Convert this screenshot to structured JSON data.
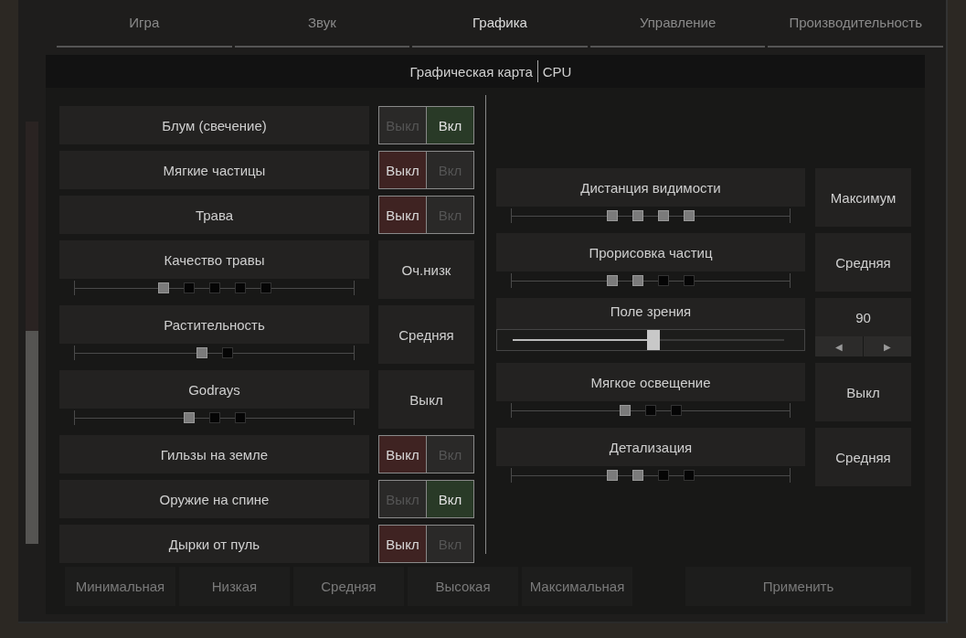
{
  "tabs": [
    {
      "label": "Игра",
      "selected": false
    },
    {
      "label": "Звук",
      "selected": false
    },
    {
      "label": "Графика",
      "selected": true
    },
    {
      "label": "Управление",
      "selected": false
    },
    {
      "label": "Производительность",
      "selected": false
    }
  ],
  "subtabs": [
    "Графическая карта",
    "CPU"
  ],
  "left_settings": [
    {
      "kind": "toggle",
      "label": "Блум (свечение)",
      "off_label": "Выкл",
      "on_label": "Вкл",
      "on": true
    },
    {
      "kind": "toggle",
      "label": "Мягкие частицы",
      "off_label": "Выкл",
      "on_label": "Вкл",
      "on": false
    },
    {
      "kind": "toggle",
      "label": "Трава",
      "off_label": "Выкл",
      "on_label": "Вкл",
      "on": false
    },
    {
      "kind": "steps",
      "label": "Качество травы",
      "value": "Оч.низк",
      "steps": [
        true,
        false,
        false,
        false,
        false
      ]
    },
    {
      "kind": "steps",
      "label": "Растительность",
      "value": "Средняя",
      "steps": [
        true,
        false
      ]
    },
    {
      "kind": "steps",
      "label": "Godrays",
      "value": "Выкл",
      "steps": [
        true,
        false,
        false
      ]
    },
    {
      "kind": "toggle",
      "label": "Гильзы на земле",
      "off_label": "Выкл",
      "on_label": "Вкл",
      "on": false
    },
    {
      "kind": "toggle",
      "label": "Оружие на спине",
      "off_label": "Выкл",
      "on_label": "Вкл",
      "on": true
    },
    {
      "kind": "toggle",
      "label": "Дырки от пуль",
      "off_label": "Выкл",
      "on_label": "Вкл",
      "on": false
    }
  ],
  "right_settings": [
    {
      "kind": "steps",
      "label": "Дистанция видимости",
      "value": "Максимум",
      "steps": [
        true,
        true,
        true,
        true
      ]
    },
    {
      "kind": "steps",
      "label": "Прорисовка частиц",
      "value": "Средняя",
      "steps": [
        true,
        true,
        false,
        false
      ]
    },
    {
      "kind": "slider",
      "label": "Поле зрения",
      "value": "90",
      "level": 0.52,
      "decrease": "◀",
      "increase": "▶"
    },
    {
      "kind": "steps",
      "label": "Мягкое освещение",
      "value": "Выкл",
      "steps": [
        true,
        false,
        false
      ]
    },
    {
      "kind": "steps",
      "label": "Детализация",
      "value": "Средняя",
      "steps": [
        true,
        true,
        false,
        false
      ]
    }
  ],
  "presets": [
    "Минимальная",
    "Низкая",
    "Средняя",
    "Высокая",
    "Максимальная"
  ],
  "apply_button": "Применить"
}
